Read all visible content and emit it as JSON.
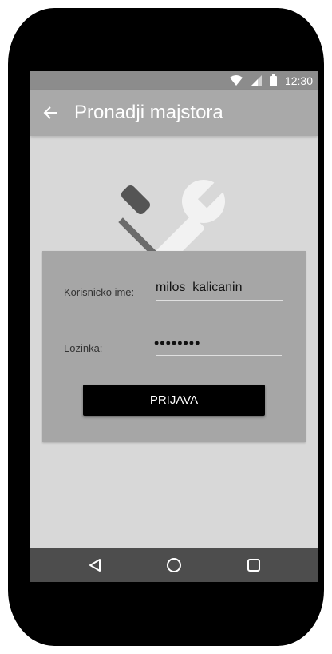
{
  "status_bar": {
    "time": "12:30",
    "icons": [
      "wifi-icon",
      "signal-icon",
      "battery-icon"
    ]
  },
  "app_bar": {
    "back_icon": "arrow-left-icon",
    "title": "Pronadji majstora"
  },
  "logo": {
    "icon": "wrench-screwdriver-icon"
  },
  "login_form": {
    "username_label": "Korisnicko ime:",
    "username_value": "milos_kalicanin",
    "password_label": "Lozinka:",
    "password_value": "••••••••",
    "submit_label": "PRIJAVA"
  },
  "nav_bar": {
    "items": [
      "back-triangle-icon",
      "home-circle-icon",
      "recents-square-icon"
    ]
  },
  "colors": {
    "frame": "#000000",
    "status_bar": "#8c8c8c",
    "app_bar": "#a9a9a9",
    "screen_bg": "#d8d8d8",
    "card_bg": "#a6a6a6",
    "button_bg": "#000000",
    "nav_bar": "#4d4d4d"
  }
}
